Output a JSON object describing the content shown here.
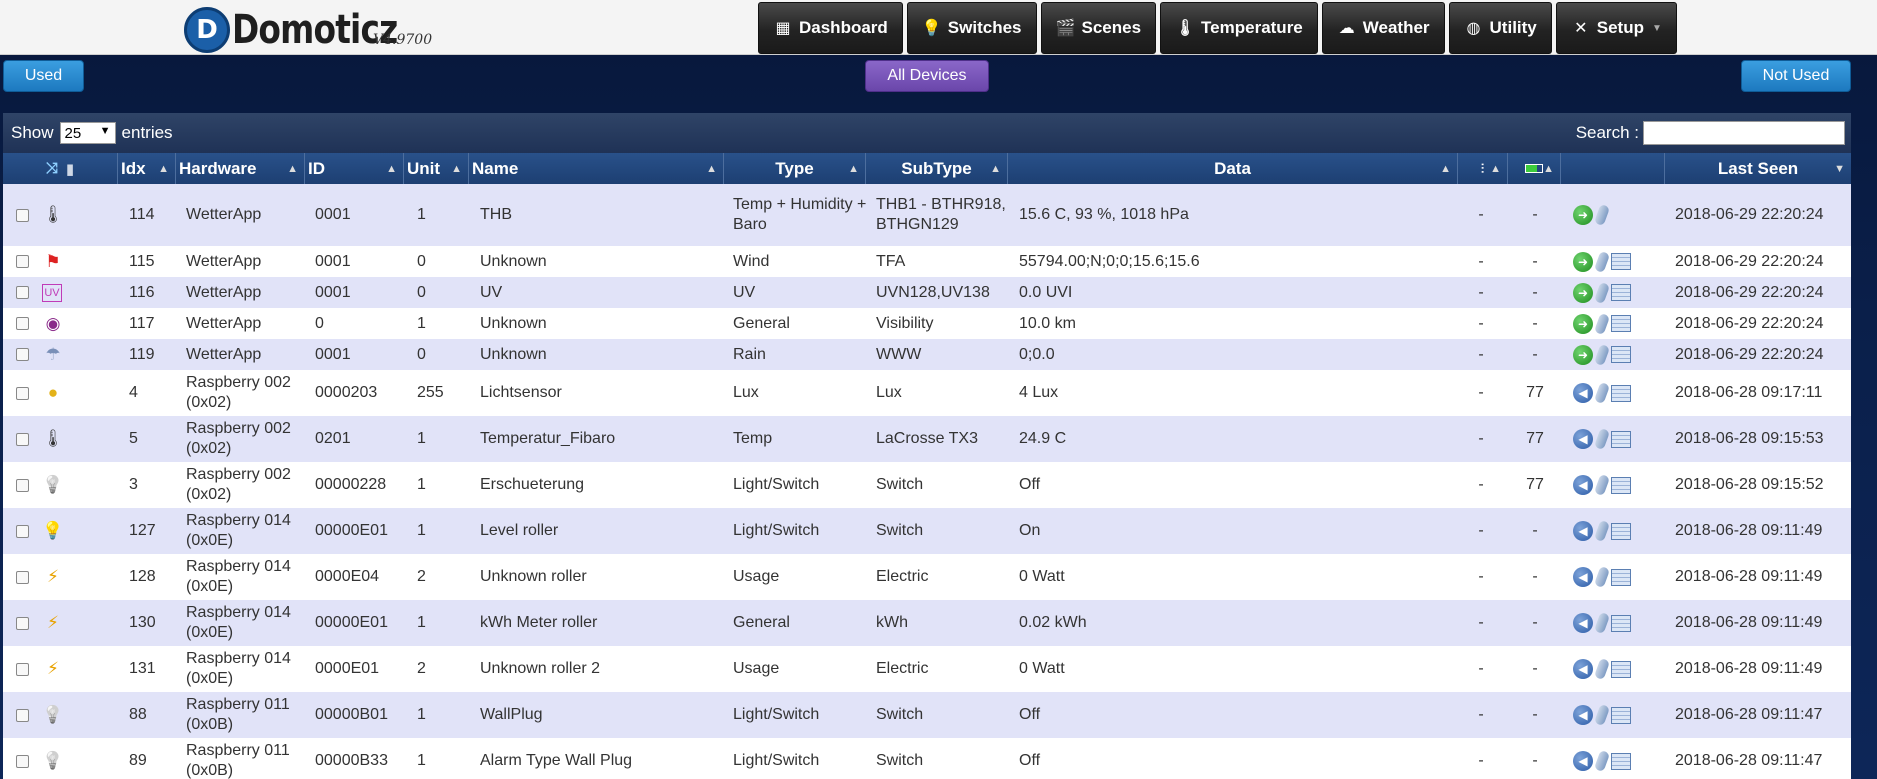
{
  "header": {
    "logo_letter": "D",
    "logo_text": "Domoticz",
    "version": "V4.9700",
    "nav": [
      {
        "label": "Dashboard",
        "icon": "dashboard-icon",
        "glyph": "▦"
      },
      {
        "label": "Switches",
        "icon": "bulb-icon",
        "glyph": "💡"
      },
      {
        "label": "Scenes",
        "icon": "clapper-icon",
        "glyph": "🎬"
      },
      {
        "label": "Temperature",
        "icon": "thermometer-icon",
        "glyph": "🌡"
      },
      {
        "label": "Weather",
        "icon": "cloud-icon",
        "glyph": "☁"
      },
      {
        "label": "Utility",
        "icon": "globe-icon",
        "glyph": "◍"
      },
      {
        "label": "Setup",
        "icon": "tools-icon",
        "glyph": "✕",
        "caret": "▼"
      }
    ]
  },
  "filters": {
    "used": "Used",
    "all": "All Devices",
    "not_used": "Not Used"
  },
  "table": {
    "show_label": "Show",
    "entries_value": "25",
    "entries_label": "entries",
    "search_label": "Search :",
    "search_value": "",
    "columns": {
      "idx": "Idx",
      "hardware": "Hardware",
      "id": "ID",
      "unit": "Unit",
      "name": "Name",
      "type": "Type",
      "subtype": "SubType",
      "data": "Data",
      "last_seen": "Last Seen"
    },
    "rows": [
      {
        "icon": "thermometer-icon",
        "glyph": "🌡",
        "idx": "114",
        "hardware": "WetterApp",
        "id": "0001",
        "unit": "1",
        "name": "THB",
        "type": "Temp + Humidity + Baro",
        "subtype": "THB1 - BTHR918, BTHGN129",
        "data": "15.6 C, 93 %, 1018 hPa",
        "signal": "-",
        "battery": "-",
        "action": "green",
        "log": false,
        "last_seen": "2018-06-29 22:20:24"
      },
      {
        "icon": "wind-flag-icon",
        "glyph": "⚑",
        "idx": "115",
        "hardware": "WetterApp",
        "id": "0001",
        "unit": "0",
        "name": "Unknown",
        "type": "Wind",
        "subtype": "TFA",
        "data": "55794.00;N;0;0;15.6;15.6",
        "signal": "-",
        "battery": "-",
        "action": "green",
        "log": true,
        "last_seen": "2018-06-29 22:20:24"
      },
      {
        "icon": "uv-icon",
        "glyph": "UV",
        "idx": "116",
        "hardware": "WetterApp",
        "id": "0001",
        "unit": "0",
        "name": "UV",
        "type": "UV",
        "subtype": "UVN128,UV138",
        "data": "0.0 UVI",
        "signal": "-",
        "battery": "-",
        "action": "green",
        "log": true,
        "last_seen": "2018-06-29 22:20:24"
      },
      {
        "icon": "eye-icon",
        "glyph": "◉",
        "idx": "117",
        "hardware": "WetterApp",
        "id": "0",
        "unit": "1",
        "name": "Unknown",
        "type": "General",
        "subtype": "Visibility",
        "data": "10.0 km",
        "signal": "-",
        "battery": "-",
        "action": "green",
        "log": true,
        "last_seen": "2018-06-29 22:20:24"
      },
      {
        "icon": "rain-icon",
        "glyph": "☂",
        "idx": "119",
        "hardware": "WetterApp",
        "id": "0001",
        "unit": "0",
        "name": "Unknown",
        "type": "Rain",
        "subtype": "WWW",
        "data": "0;0.0",
        "signal": "-",
        "battery": "-",
        "action": "green",
        "log": true,
        "last_seen": "2018-06-29 22:20:24"
      },
      {
        "icon": "lux-icon",
        "glyph": "●",
        "idx": "4",
        "hardware": "Raspberry 002 (0x02)",
        "id": "0000203",
        "unit": "255",
        "name": "Lichtsensor",
        "type": "Lux",
        "subtype": "Lux",
        "data": "4 Lux",
        "signal": "-",
        "battery": "77",
        "action": "blue",
        "log": true,
        "last_seen": "2018-06-28 09:17:11"
      },
      {
        "icon": "thermometer-icon",
        "glyph": "🌡",
        "idx": "5",
        "hardware": "Raspberry 002 (0x02)",
        "id": "0201",
        "unit": "1",
        "name": "Temperatur_Fibaro",
        "type": "Temp",
        "subtype": "LaCrosse TX3",
        "data": "24.9 C",
        "signal": "-",
        "battery": "77",
        "action": "blue",
        "log": true,
        "last_seen": "2018-06-28 09:15:53"
      },
      {
        "icon": "bulb-off-icon",
        "glyph": "💡",
        "idx": "3",
        "hardware": "Raspberry 002 (0x02)",
        "id": "00000228",
        "unit": "1",
        "name": "Erschueterung",
        "type": "Light/Switch",
        "subtype": "Switch",
        "data": "Off",
        "signal": "-",
        "battery": "77",
        "action": "blue",
        "log": true,
        "last_seen": "2018-06-28 09:15:52"
      },
      {
        "icon": "bulb-on-icon",
        "glyph": "💡",
        "idx": "127",
        "hardware": "Raspberry 014 (0x0E)",
        "id": "00000E01",
        "unit": "1",
        "name": "Level roller",
        "type": "Light/Switch",
        "subtype": "Switch",
        "data": "On",
        "signal": "-",
        "battery": "-",
        "action": "blue",
        "log": true,
        "last_seen": "2018-06-28 09:11:49"
      },
      {
        "icon": "energy-icon",
        "glyph": "⚡",
        "idx": "128",
        "hardware": "Raspberry 014 (0x0E)",
        "id": "0000E04",
        "unit": "2",
        "name": "Unknown roller",
        "type": "Usage",
        "subtype": "Electric",
        "data": "0 Watt",
        "signal": "-",
        "battery": "-",
        "action": "blue",
        "log": true,
        "last_seen": "2018-06-28 09:11:49"
      },
      {
        "icon": "energy-icon",
        "glyph": "⚡",
        "idx": "130",
        "hardware": "Raspberry 014 (0x0E)",
        "id": "00000E01",
        "unit": "1",
        "name": "kWh Meter roller",
        "type": "General",
        "subtype": "kWh",
        "data": "0.02 kWh",
        "signal": "-",
        "battery": "-",
        "action": "blue",
        "log": true,
        "last_seen": "2018-06-28 09:11:49"
      },
      {
        "icon": "energy-icon",
        "glyph": "⚡",
        "idx": "131",
        "hardware": "Raspberry 014 (0x0E)",
        "id": "0000E01",
        "unit": "2",
        "name": "Unknown roller 2",
        "type": "Usage",
        "subtype": "Electric",
        "data": "0 Watt",
        "signal": "-",
        "battery": "-",
        "action": "blue",
        "log": true,
        "last_seen": "2018-06-28 09:11:49"
      },
      {
        "icon": "bulb-off-icon",
        "glyph": "💡",
        "idx": "88",
        "hardware": "Raspberry 011 (0x0B)",
        "id": "00000B01",
        "unit": "1",
        "name": "WallPlug",
        "type": "Light/Switch",
        "subtype": "Switch",
        "data": "Off",
        "signal": "-",
        "battery": "-",
        "action": "blue",
        "log": true,
        "last_seen": "2018-06-28 09:11:47"
      },
      {
        "icon": "bulb-off-icon",
        "glyph": "💡",
        "idx": "89",
        "hardware": "Raspberry 011 (0x0B)",
        "id": "00000B33",
        "unit": "1",
        "name": "Alarm Type Wall Plug",
        "type": "Light/Switch",
        "subtype": "Switch",
        "data": "Off",
        "signal": "-",
        "battery": "-",
        "action": "blue",
        "log": true,
        "last_seen": "2018-06-28 09:11:47"
      }
    ]
  }
}
